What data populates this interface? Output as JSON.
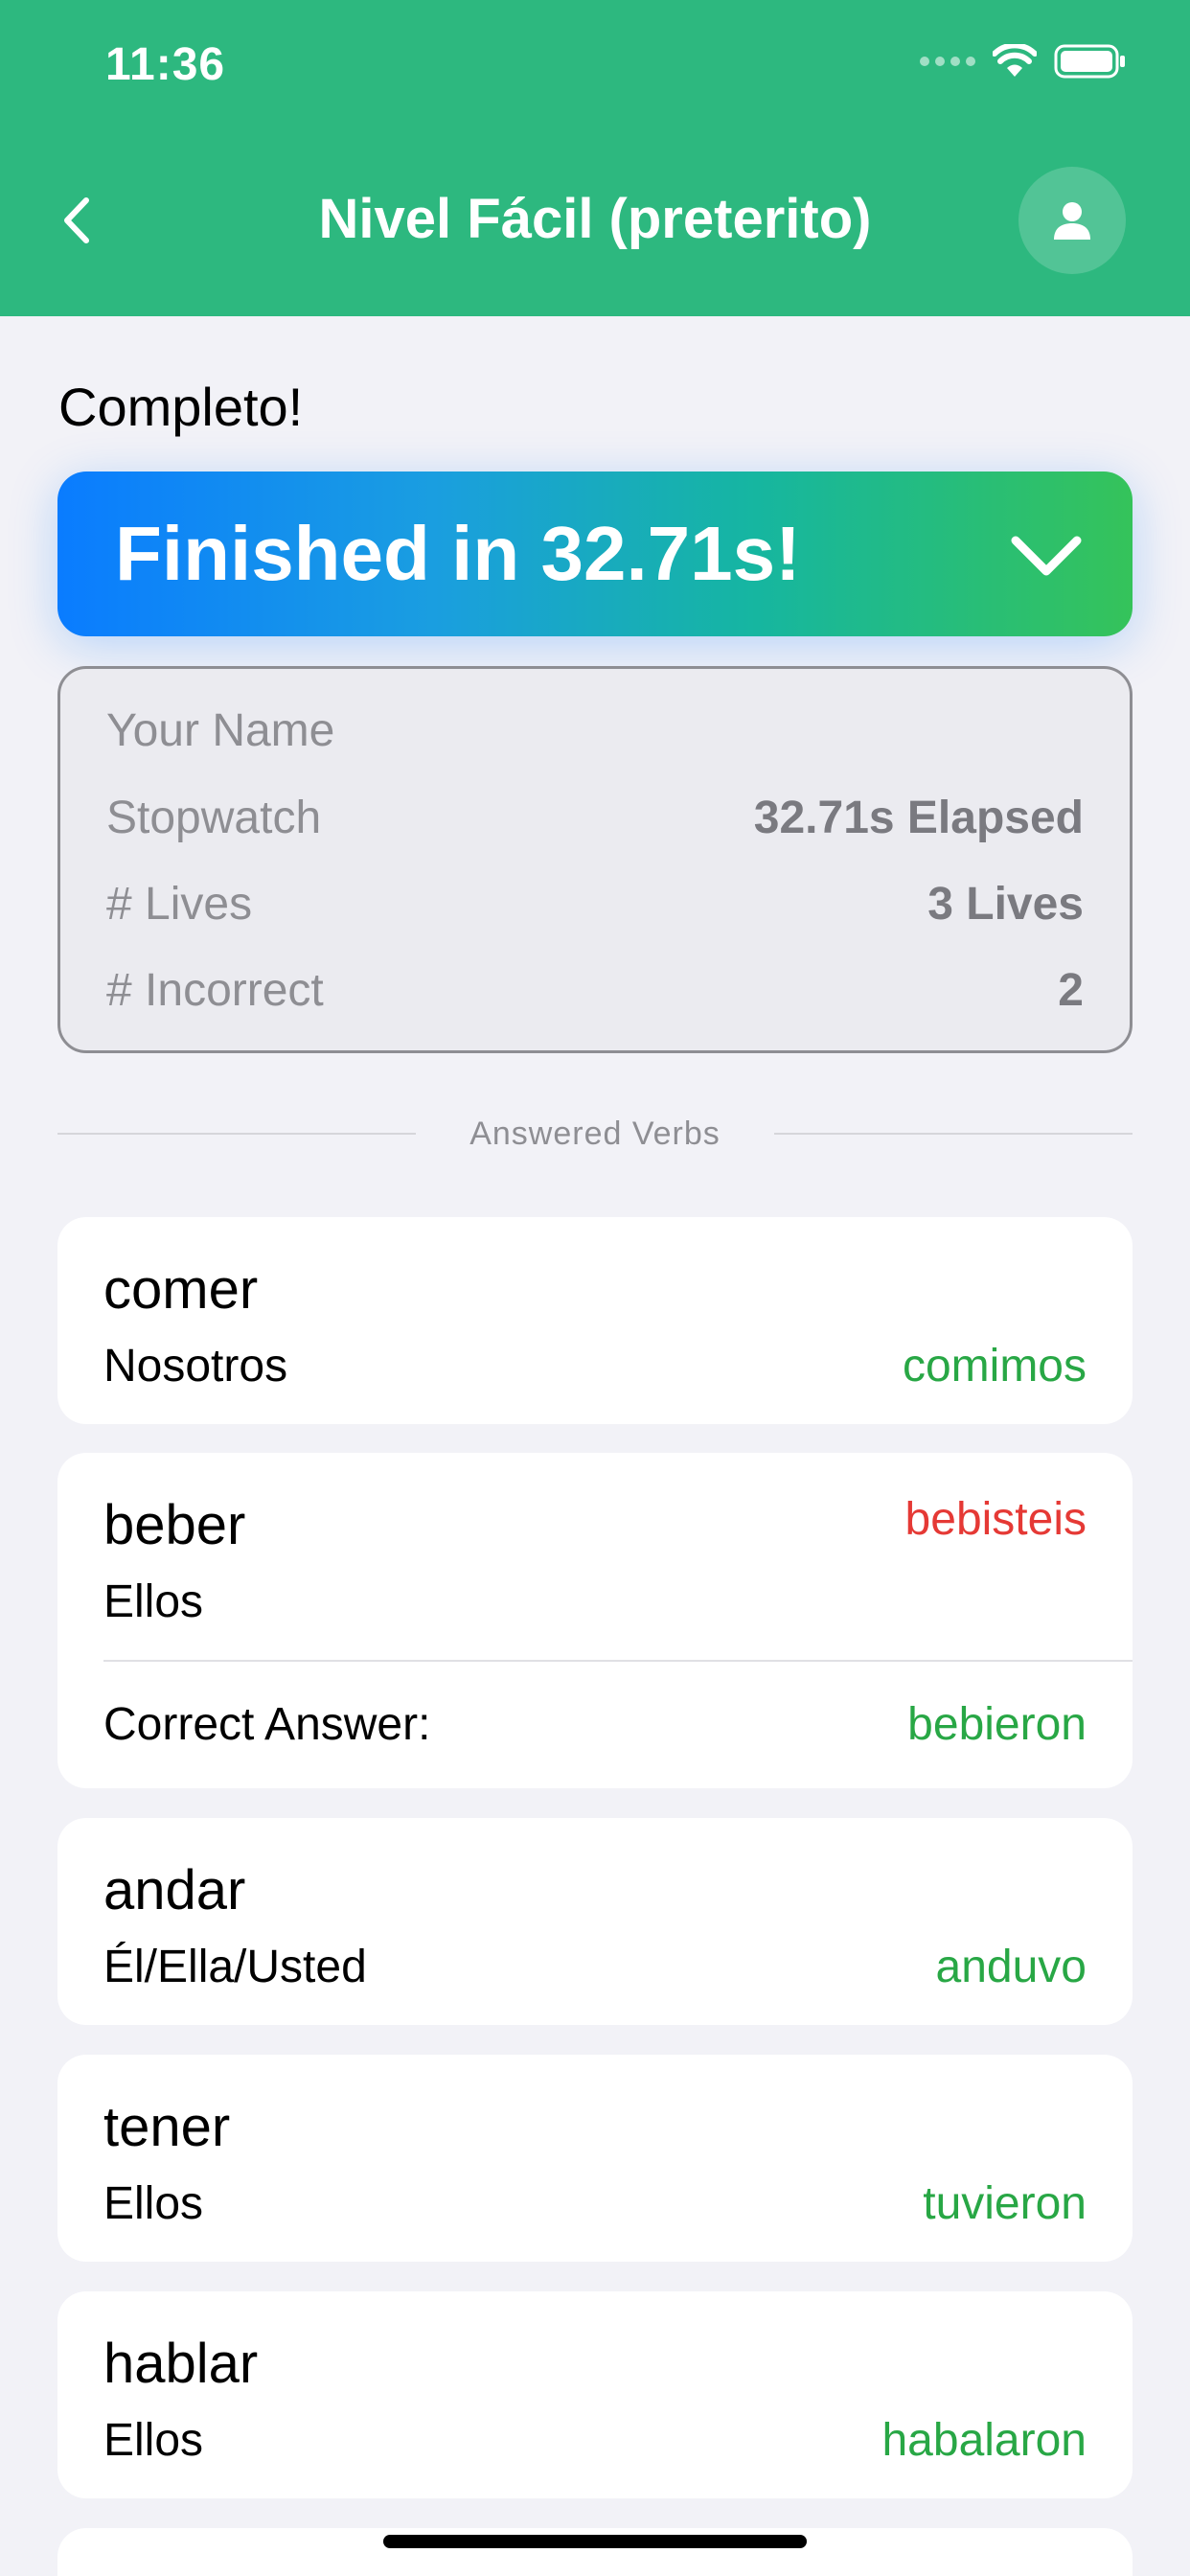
{
  "status_bar": {
    "time": "11:36"
  },
  "nav": {
    "title": "Nivel Fácil (preterito)",
    "back_icon": "chevron-left-icon",
    "profile_icon": "person-icon"
  },
  "section_title": "Completo!",
  "banner": {
    "text": "Finished in 32.71s!",
    "icon": "chevron-down-icon"
  },
  "stats": {
    "name_placeholder": "Your Name",
    "stopwatch_label": "Stopwatch",
    "stopwatch_value": "32.71s Elapsed",
    "lives_label": "# Lives",
    "lives_value": "3 Lives",
    "incorrect_label": "# Incorrect",
    "incorrect_value": "2"
  },
  "answered_header": "Answered Verbs",
  "verbs": [
    {
      "verb": "comer",
      "pronoun": "Nosotros",
      "answer": "comimos"
    },
    {
      "verb": "beber",
      "pronoun": "Ellos",
      "answer": "bebisteis",
      "correct_label": "Correct Answer:",
      "correct_answer": "bebieron"
    },
    {
      "verb": "andar",
      "pronoun": "Él/Ella/Usted",
      "answer": "anduvo"
    },
    {
      "verb": "tener",
      "pronoun": "Ellos",
      "answer": "tuvieron"
    },
    {
      "verb": "hablar",
      "pronoun": "Ellos",
      "answer": "habalaron"
    }
  ],
  "colors": {
    "header_green": "#2db87f",
    "correct_green": "#28a745",
    "incorrect_red": "#e53935",
    "gradient_start": "#0a7cff",
    "gradient_end": "#35c35a"
  }
}
